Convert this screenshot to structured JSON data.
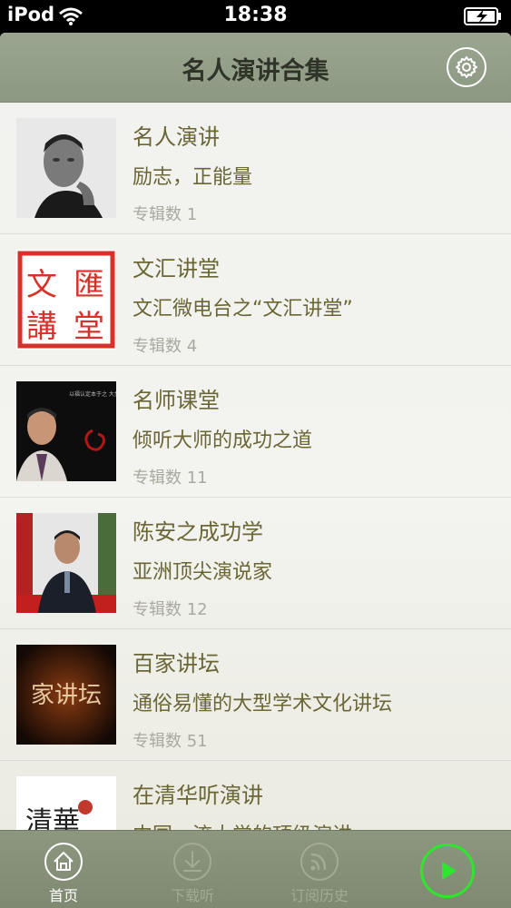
{
  "status": {
    "carrier": "iPod",
    "time": "18:38"
  },
  "nav": {
    "title": "名人演讲合集"
  },
  "items": [
    {
      "title": "名人演讲",
      "subtitle": "励志，正能量",
      "count": "专辑数 1",
      "thumb": "portrait"
    },
    {
      "title": "文汇讲堂",
      "subtitle": "文汇微电台之“文汇讲堂”",
      "count": "专辑数 4",
      "thumb": "seal"
    },
    {
      "title": "名师课堂",
      "subtitle": "倾听大师的成功之道",
      "count": "专辑数 11",
      "thumb": "speaker-dark"
    },
    {
      "title": "陈安之成功学",
      "subtitle": "亚洲顶尖演说家",
      "count": "专辑数 12",
      "thumb": "speaker-red"
    },
    {
      "title": "百家讲坛",
      "subtitle": "通俗易懂的大型学术文化讲坛",
      "count": "专辑数 51",
      "thumb": "lecture"
    },
    {
      "title": "在清华听演讲",
      "subtitle": "中国一流大学的顶级演讲",
      "count": "",
      "thumb": "calligraphy"
    }
  ],
  "thumb_text": {
    "seal": [
      "文",
      "匯",
      "講",
      "堂"
    ],
    "speaker_dark": "以福认定本于之 大步大光义",
    "lecture": "家讲坛",
    "calligraphy": "清華"
  },
  "tabs": [
    {
      "label": "首页",
      "icon": "home-icon",
      "active": true
    },
    {
      "label": "下载听",
      "icon": "download-icon",
      "active": false
    },
    {
      "label": "订阅历史",
      "icon": "rss-icon",
      "active": false
    }
  ],
  "colors": {
    "nav_bg": "#929d87",
    "title_text": "#6a6635",
    "count_text": "#a9a9a0",
    "play_accent": "#2ee62e"
  }
}
